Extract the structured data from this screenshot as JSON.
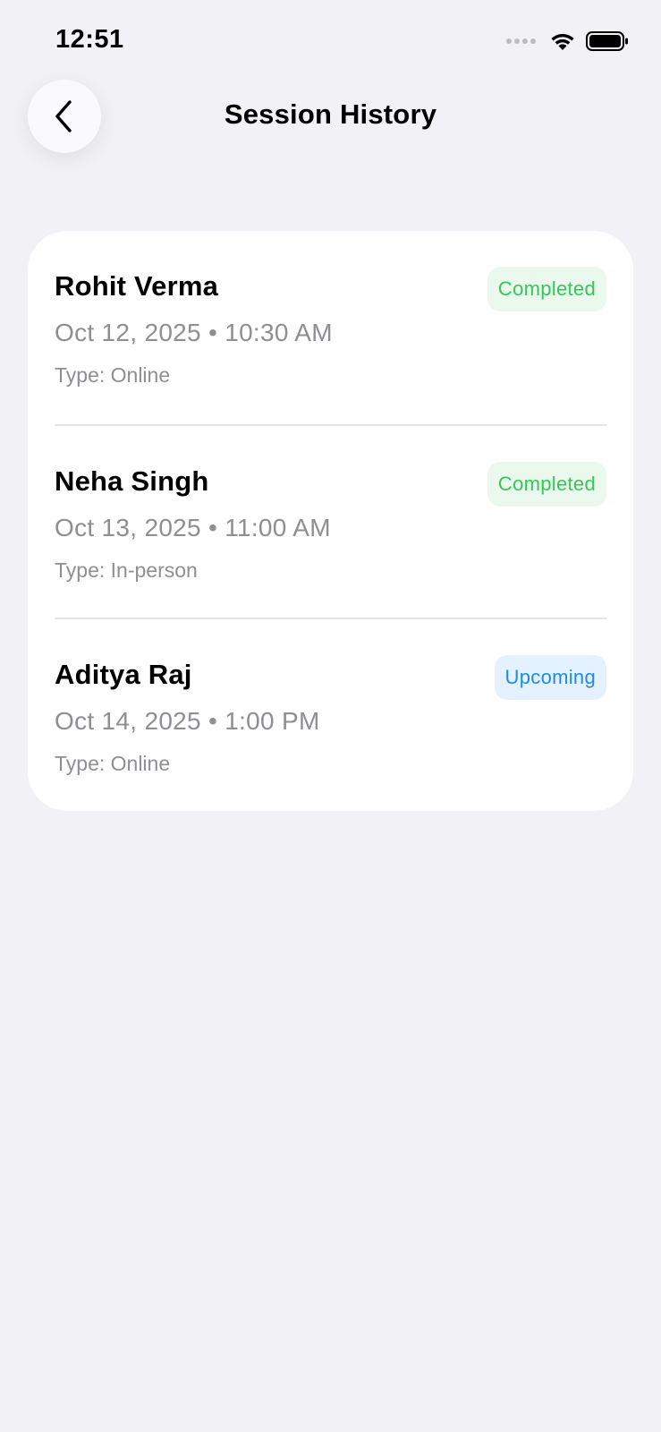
{
  "status_bar": {
    "time": "12:51"
  },
  "header": {
    "title": "Session History",
    "back_icon": "chevron-left-icon"
  },
  "colors": {
    "background": "#F1F1F6",
    "card": "#FFFFFF",
    "completed_text": "#34C759",
    "completed_bg": "#EAF8EE",
    "upcoming_text": "#1E8BE0",
    "upcoming_bg": "#E4F1FE",
    "secondary_text": "#8E8E93"
  },
  "sessions": [
    {
      "name": "Rohit Verma",
      "datetime": "Oct 12, 2025 • 10:30 AM",
      "type": "Type: Online",
      "status": "Completed"
    },
    {
      "name": "Neha Singh",
      "datetime": "Oct 13, 2025 • 11:00 AM",
      "type": "Type: In-person",
      "status": "Completed"
    },
    {
      "name": "Aditya Raj",
      "datetime": "Oct 14, 2025 • 1:00 PM",
      "type": "Type: Online",
      "status": "Upcoming"
    }
  ]
}
